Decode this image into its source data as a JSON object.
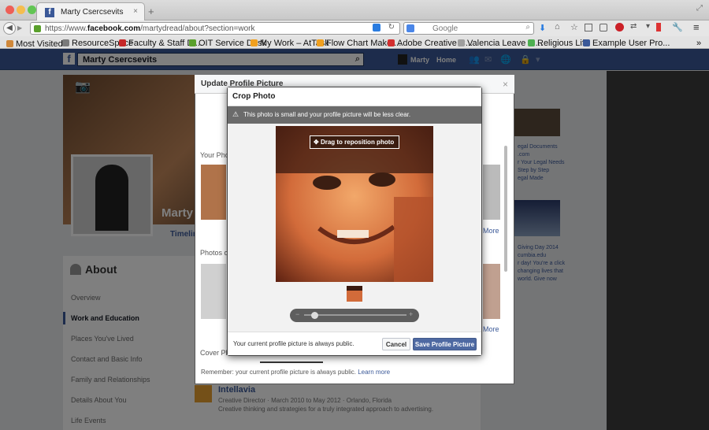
{
  "browser": {
    "tab_title": "Marty Csercsevits",
    "url_prefix": "https://www.",
    "url_domain": "facebook.com",
    "url_path": "/martydread/about?section=work",
    "search_placeholder": "Google",
    "bookmarks": [
      {
        "label": "Most Visited",
        "color": "#d0883a"
      },
      {
        "label": "ResourceSpace",
        "color": "#7a7a7a"
      },
      {
        "label": "Faculty & Staff Di...",
        "color": "#c62828"
      },
      {
        "label": "OIT Service Desk",
        "color": "#5aa02c"
      },
      {
        "label": "My Work – AtTask",
        "color": "#f0a020"
      },
      {
        "label": "Flow Chart Maker...",
        "color": "#f0a020"
      },
      {
        "label": "Adobe Creative C...",
        "color": "#d32f2f"
      },
      {
        "label": "Valencia Leave – ...",
        "color": "#9e9e9e"
      },
      {
        "label": "Religious Life",
        "color": "#4caf50"
      },
      {
        "label": "Example User Pro...",
        "color": "#3b5998"
      }
    ]
  },
  "fb": {
    "search_value": "Marty Csercsevits",
    "user_name": "Marty",
    "home_label": "Home",
    "profile_name": "Marty",
    "timeline_label": "Timeline",
    "your_photos_label": "Your Photos",
    "photos_of_label": "Photos of",
    "cover_label": "Cover Ph",
    "more_label": "More",
    "more_label2": "More",
    "about_title": "About",
    "about_items": [
      "Overview",
      "Work and Education",
      "Places You've Lived",
      "Contact and Basic Info",
      "Family and Relationships",
      "Details About You",
      "Life Events"
    ],
    "work_company": "Intellavia",
    "work_detail": "Creative Director · March 2010 to May 2012 · Orlando, Florida",
    "work_desc": "Creative thinking and strategies for a truly integrated approach to advertising.",
    "ad1": "egal Documents\n.com\nr Your Legal Needs\nStep by Step\negal Made",
    "ad2": "Giving Day 2014\ncumbia.edu\nr day! You're a click\nchanging lives that\nworld. Give now"
  },
  "dialog": {
    "outer_title": "Update Profile Picture",
    "outer_footer_text": "Remember: your current profile picture is always public.",
    "outer_footer_link": "Learn more",
    "crop_title": "Crop Photo",
    "warning": "This photo is small and your profile picture will be less clear.",
    "drag_label": "Drag to reposition photo",
    "zoom_level": 0.1,
    "footer_note": "Your current profile picture is always public.",
    "cancel_label": "Cancel",
    "save_label": "Save Profile Picture"
  }
}
